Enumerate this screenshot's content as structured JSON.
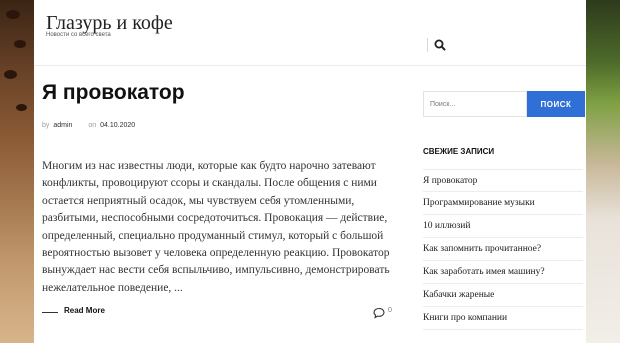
{
  "header": {
    "site_title": "Глазурь и кофе",
    "site_description": "Новости со всего света",
    "search_icon": "search-icon"
  },
  "post": {
    "title": "Я провокатор",
    "by_label": "by",
    "author": "admin",
    "on_label": "on",
    "date": "04.10.2020",
    "excerpt": "Многим из нас известны люди, которые как будто нарочно затевают конфликты, провоцируют ссоры и скандалы. После общения с ними остается неприятный осадок, мы чувствуем себя утомленными, разбитыми, неспособными сосредоточиться. Провокация — действие, определенный, специально продуманный стимул, который с большой вероятностью вызовет у человека определенную реакцию. Провокатор вынуждает нас вести себя вспыльчиво, импульсивно, демонстрировать нежелательное поведение, ...",
    "read_more": "Read More",
    "comment_icon": "comment-icon",
    "comments_count": "0"
  },
  "sidebar": {
    "search_placeholder": "Поиск...",
    "search_button": "ПОИСК",
    "recent_title": "СВЕЖИЕ ЗАПИСИ",
    "recent_posts": [
      "Я провокатор",
      "Программирование музыки",
      "10 иллюзий",
      "Как запомнить прочитанное?",
      "Как заработать имея машину?",
      "Кабачки жареные",
      "Книги про компании"
    ]
  },
  "colors": {
    "accent": "#2f6fd6",
    "text": "#333333",
    "heading": "#111111"
  }
}
